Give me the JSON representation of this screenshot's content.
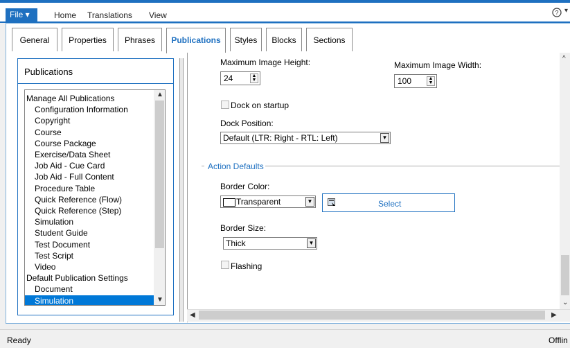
{
  "ribbon": {
    "file_label": "File ▾",
    "tabs": [
      "Home",
      "Translations",
      "View"
    ],
    "help_icon": "?"
  },
  "tabs": [
    "General",
    "Properties",
    "Phrases",
    "Publications",
    "Styles",
    "Blocks",
    "Sections"
  ],
  "active_tab": "Publications",
  "left": {
    "title": "Publications",
    "items": [
      {
        "label": "Manage All Publications",
        "indent": 0
      },
      {
        "label": "Configuration Information",
        "indent": 1
      },
      {
        "label": "Copyright",
        "indent": 1
      },
      {
        "label": "Course",
        "indent": 1
      },
      {
        "label": "Course Package",
        "indent": 1
      },
      {
        "label": "Exercise/Data Sheet",
        "indent": 1
      },
      {
        "label": "Job Aid - Cue Card",
        "indent": 1
      },
      {
        "label": "Job Aid - Full Content",
        "indent": 1
      },
      {
        "label": "Procedure Table",
        "indent": 1
      },
      {
        "label": "Quick Reference (Flow)",
        "indent": 1
      },
      {
        "label": "Quick Reference (Step)",
        "indent": 1
      },
      {
        "label": "Simulation",
        "indent": 1
      },
      {
        "label": "Student Guide",
        "indent": 1
      },
      {
        "label": "Test Document",
        "indent": 1
      },
      {
        "label": "Test Script",
        "indent": 1
      },
      {
        "label": "Video",
        "indent": 1
      },
      {
        "label": "Default Publication Settings",
        "indent": 0
      },
      {
        "label": "Document",
        "indent": 1
      },
      {
        "label": "Simulation",
        "indent": 1,
        "selected": true
      }
    ]
  },
  "right": {
    "max_height_label": "Maximum Image Height:",
    "max_height_value": "24",
    "max_width_label": "Maximum Image Width:",
    "max_width_value": "100",
    "dock_startup_label": "Dock on startup",
    "dock_position_label": "Dock Position:",
    "dock_position_value": "Default (LTR: Right - RTL: Left)",
    "action_defaults_label": "Action Defaults",
    "border_color_label": "Border Color:",
    "border_color_value": "Transparent",
    "select_label": "Select",
    "border_size_label": "Border Size:",
    "border_size_value": "Thick",
    "flashing_label": "Flashing"
  },
  "status": {
    "left": "Ready",
    "right": "Offlin"
  },
  "colors": {
    "accent": "#1e70c0",
    "selection": "#0078d7"
  }
}
